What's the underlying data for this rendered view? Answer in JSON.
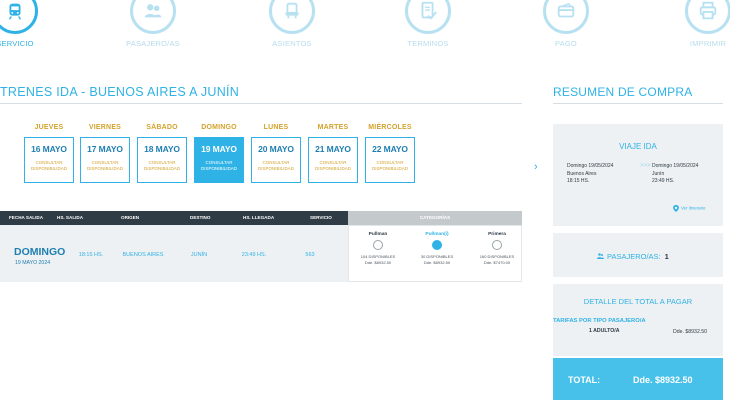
{
  "steps": [
    {
      "label": "SERVICIO",
      "icon": "train-icon",
      "active": true
    },
    {
      "label": "PASAJERO/AS",
      "icon": "passengers-icon",
      "active": false
    },
    {
      "label": "ASIENTOS",
      "icon": "seat-icon",
      "active": false
    },
    {
      "label": "TERMINOS",
      "icon": "terms-icon",
      "active": false
    },
    {
      "label": "PAGO",
      "icon": "payment-icon",
      "active": false
    },
    {
      "label": "IMPRIMIR",
      "icon": "print-icon",
      "active": false
    }
  ],
  "title": "TRENES IDA - BUENOS AIRES  A  JUNÍN",
  "days": [
    {
      "name": "JUEVES",
      "date": "16 MAYO",
      "sub1": "CONSULTAR",
      "sub2": "DISPONIBILIDAD",
      "selected": false
    },
    {
      "name": "VIERNES",
      "date": "17 MAYO",
      "sub1": "CONSULTAR",
      "sub2": "DISPONIBILIDAD",
      "selected": false
    },
    {
      "name": "SÁBADO",
      "date": "18 MAYO",
      "sub1": "CONSULTAR",
      "sub2": "DISPONIBILIDAD",
      "selected": false
    },
    {
      "name": "DOMINGO",
      "date": "19 MAYO",
      "sub1": "CONSULTAR",
      "sub2": "DISPONIBILIDAD",
      "selected": true
    },
    {
      "name": "LUNES",
      "date": "20 MAYO",
      "sub1": "CONSULTAR",
      "sub2": "DISPONIBILIDAD",
      "selected": false
    },
    {
      "name": "MARTES",
      "date": "21 MAYO",
      "sub1": "CONSULTAR",
      "sub2": "DISPONIBILIDAD",
      "selected": false
    },
    {
      "name": "MIÉRCOLES",
      "date": "22 MAYO",
      "sub1": "CONSULTAR",
      "sub2": "DISPONIBILIDAD",
      "selected": false
    }
  ],
  "nav": {
    "prev": "‹",
    "next": "›"
  },
  "table": {
    "headers": {
      "fecha_salida": "FECHA SALIDA",
      "hs_salida": "HS. SALIDA",
      "origen": "ORIGEN",
      "destino": "DESTINO",
      "hs_llegada": "HS. LLEGADA",
      "servicio": "SERVICIO",
      "categorias": "CATEGORÍAS"
    },
    "row": {
      "day": "DOMINGO",
      "date": "19 MAYO 2024",
      "hs_salida": "18:15 HS.",
      "origen": "BUENOS AIRES",
      "destino": "JUNÍN",
      "hs_llegada": "23:49 HS.",
      "servicio": "563"
    },
    "categories": [
      {
        "name": "Pullman",
        "avail": "104 DISPONIBLES",
        "price": "Dde. $8932.50",
        "selected": false
      },
      {
        "name": "Pullman(i)",
        "avail": "30 DISPONIBLES",
        "price": "Dde. $8932.50",
        "selected": true
      },
      {
        "name": "Primera",
        "avail": "160 DISPONIBLES",
        "price": "Dde. $7470.00",
        "selected": false
      }
    ]
  },
  "summary": {
    "title": "RESUMEN DE COMPRA",
    "viaje_title": "VIAJE IDA",
    "origin_date": "Domingo 19/05/2024",
    "origin_city": "Buenos Aires",
    "origin_time": "18:15 HS.",
    "arrows": ">>>",
    "dest_date": "Domingo 19/05/2024",
    "dest_city": "Junín",
    "dest_time": "23:49 HS.",
    "itinerary_link": "Ver Itinerario",
    "pax_label": "PASAJERO/AS:",
    "pax_count": "1",
    "detail_title": "DETALLE DEL TOTAL A PAGAR",
    "tarifas_label": "TARIFAS POR TIPO PASAJERO/A",
    "adult_label": "1 ADULTO/A",
    "adult_price": "Dde. $8932.50",
    "total_label": "TOTAL:",
    "total_value": "Dde. $8932.50"
  },
  "colors": {
    "accent": "#2fb2e5",
    "dark": "#2f3b45",
    "gold": "#d4a22c",
    "panel": "#eef1f3"
  }
}
